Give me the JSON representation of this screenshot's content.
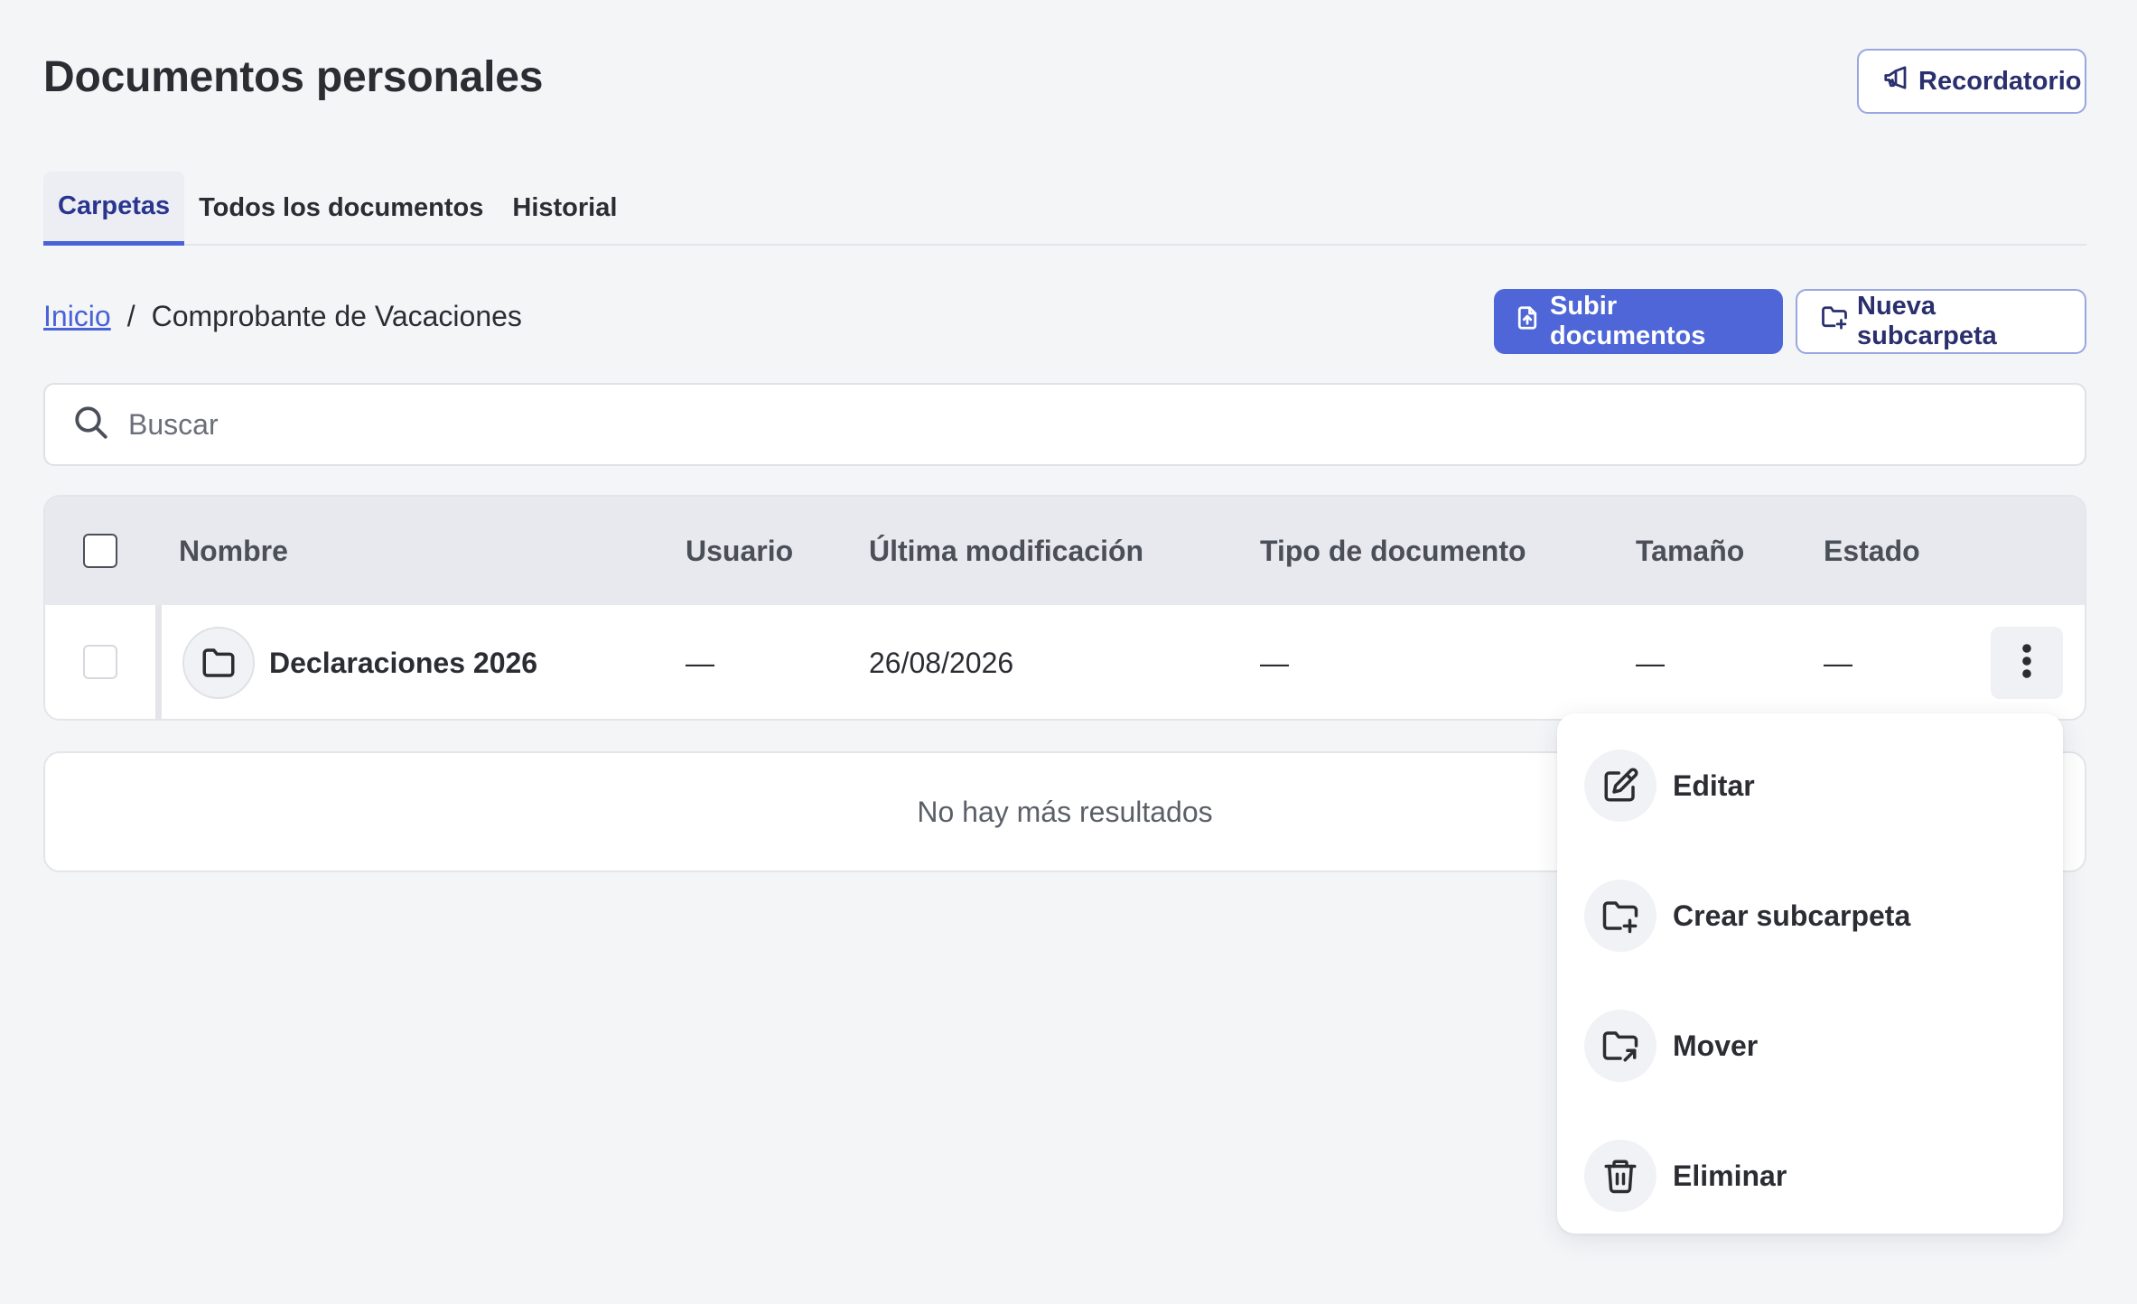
{
  "header": {
    "title": "Documentos personales",
    "reminder_label": "Recordatorio",
    "reminder_icon": "megaphone-icon"
  },
  "tabs": [
    {
      "label": "Carpetas",
      "active": true
    },
    {
      "label": "Todos los documentos",
      "active": false
    },
    {
      "label": "Historial",
      "active": false
    }
  ],
  "breadcrumb": {
    "home": "Inicio",
    "separator": "/",
    "current": "Comprobante de Vacaciones"
  },
  "actions": {
    "upload_label": "Subir documentos",
    "new_subfolder_label": "Nueva subcarpeta"
  },
  "search": {
    "placeholder": "Buscar",
    "value": ""
  },
  "table": {
    "columns": [
      "Nombre",
      "Usuario",
      "Última modificación",
      "Tipo de documento",
      "Tamaño",
      "Estado"
    ],
    "rows": [
      {
        "name": "Declaraciones 2026",
        "user": "—",
        "modified": "26/08/2026",
        "doc_type": "—",
        "size": "—",
        "status": "—",
        "icon": "folder-icon"
      }
    ]
  },
  "no_more_results": "No hay más resultados",
  "context_menu": {
    "items": [
      {
        "label": "Editar",
        "icon": "edit-icon"
      },
      {
        "label": "Crear subcarpeta",
        "icon": "folder-plus-icon"
      },
      {
        "label": "Mover",
        "icon": "folder-move-icon"
      },
      {
        "label": "Eliminar",
        "icon": "trash-icon"
      }
    ]
  },
  "colors": {
    "accent": "#4f66d8",
    "tab_active_text": "#2a3590",
    "background": "#f4f5f7"
  }
}
